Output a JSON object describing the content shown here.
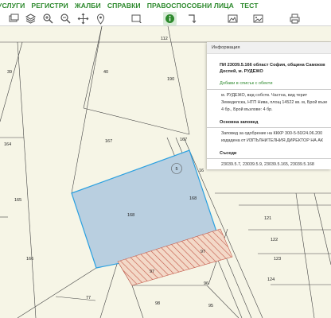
{
  "menu": {
    "items": [
      "УСЛУГИ",
      "РЕГИСТРИ",
      "ЖАЛБИ",
      "СПРАВКИ",
      "ПРАВОСПОСОБНИ ЛИЦА",
      "ТЕСТ"
    ]
  },
  "toolbar": {
    "tools": [
      {
        "name": "layers-icon",
        "active": false
      },
      {
        "name": "stack-layers-icon",
        "active": false
      },
      {
        "name": "zoom-in-icon",
        "active": false
      },
      {
        "name": "zoom-out-icon",
        "active": false
      },
      {
        "name": "pan-icon",
        "active": false
      },
      {
        "name": "location-pin-icon",
        "active": false
      },
      {
        "name": "select-rectangle-icon",
        "active": false
      },
      {
        "name": "identify-info-icon",
        "active": true
      },
      {
        "name": "redirect-arrow-icon",
        "active": false
      },
      {
        "name": "map-window-icon",
        "active": false
      },
      {
        "name": "picture-icon",
        "active": false
      },
      {
        "name": "print-icon",
        "active": false
      }
    ]
  },
  "map": {
    "parcel_labels": [
      {
        "text": "112"
      },
      {
        "text": "39"
      },
      {
        "text": "40"
      },
      {
        "text": "190"
      },
      {
        "text": "164"
      },
      {
        "text": "167"
      },
      {
        "text": "167"
      },
      {
        "text": "16"
      },
      {
        "text": "165"
      },
      {
        "text": "168"
      },
      {
        "text": "168"
      },
      {
        "text": "121"
      },
      {
        "text": "122"
      },
      {
        "text": "166"
      },
      {
        "text": "97"
      },
      {
        "text": "123"
      },
      {
        "text": "97"
      },
      {
        "text": "96"
      },
      {
        "text": "77"
      },
      {
        "text": "98"
      },
      {
        "text": "95"
      },
      {
        "text": "124"
      }
    ],
    "marker_label": "5",
    "colors": {
      "background": "#f6f5e6",
      "selected_fill": "#b9cfe0",
      "selected_stroke": "#2aa0e0",
      "hatch": "#c45a4a",
      "hatch_bg": "#f3d9c8"
    }
  },
  "info": {
    "header": "Информация",
    "title_line1": "ПИ 23039.5.166 област София, община Самоков",
    "title_line2": "Доспей, м. РУДЕЖО",
    "add_link": "Добави в списък с обекти",
    "desc_line1": "м. РУДЕЖО, вид собств. Частна, вид терит",
    "desc_line2": "Земеделска, НТП Нива, площ 14522 кв. м, Брой възе",
    "desc_line3": "4 бр., Брой възлове: 4 бр.",
    "order_heading": "Основна заповед",
    "order_line1": "Заповед за одобрение на КККР 300-5-50/24.06.200",
    "order_line2": "издадена от ИЗПЪЛНИТЕЛНИЯ ДИРЕКТОР НА АК",
    "neighbors_heading": "Съседи",
    "neighbors": "23039.5.7, 23039.5.9, 23039.5.165, 23039.5.168"
  }
}
